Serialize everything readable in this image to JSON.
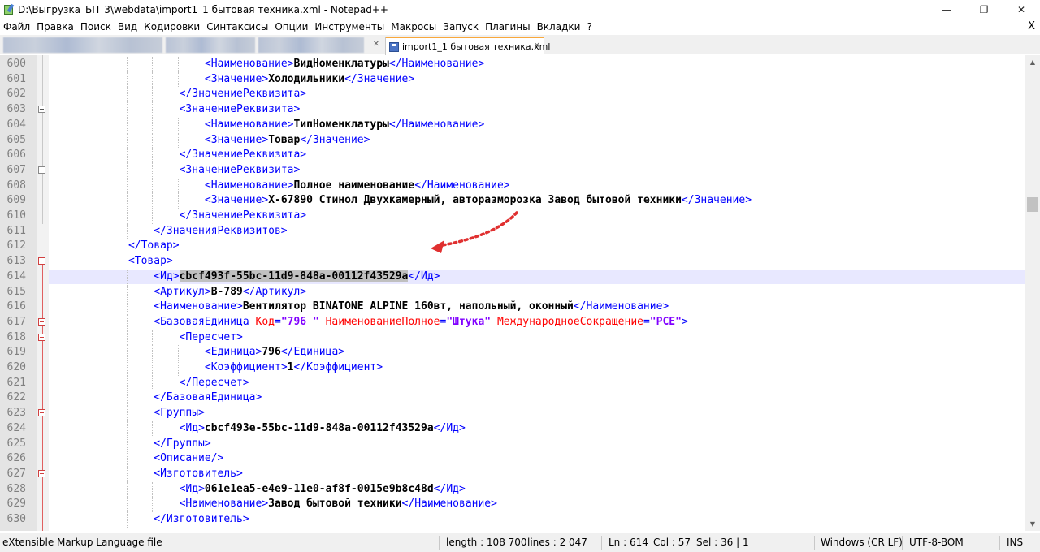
{
  "window": {
    "title": "D:\\Выгрузка_БП_3\\webdata\\import1_1 бытовая техника.xml - Notepad++",
    "minimize": "—",
    "maximize": "❐",
    "close": "✕"
  },
  "menu": {
    "items": [
      "Файл",
      "Правка",
      "Поиск",
      "Вид",
      "Кодировки",
      "Синтаксисы",
      "Опции",
      "Инструменты",
      "Макросы",
      "Запуск",
      "Плагины",
      "Вкладки",
      "?"
    ],
    "close": "X"
  },
  "tabs": {
    "active_label": "import1_1 бытовая техника.xml",
    "close_glyph": "✕"
  },
  "editor": {
    "lines": [
      {
        "n": "600",
        "parts": [
          [
            "t",
            "<Наименование>"
          ],
          [
            "x",
            "ВидНоменклатуры"
          ],
          [
            "t",
            "</Наименование>"
          ]
        ],
        "indent": 6
      },
      {
        "n": "601",
        "parts": [
          [
            "t",
            "<Значение>"
          ],
          [
            "x",
            "Холодильники"
          ],
          [
            "t",
            "</Значение>"
          ]
        ],
        "indent": 6
      },
      {
        "n": "602",
        "parts": [
          [
            "t",
            "</ЗначениеРеквизита>"
          ]
        ],
        "indent": 5
      },
      {
        "n": "603",
        "parts": [
          [
            "t",
            "<ЗначениеРеквизита>"
          ]
        ],
        "indent": 5,
        "fold": "open"
      },
      {
        "n": "604",
        "parts": [
          [
            "t",
            "<Наименование>"
          ],
          [
            "x",
            "ТипНоменклатуры"
          ],
          [
            "t",
            "</Наименование>"
          ]
        ],
        "indent": 6
      },
      {
        "n": "605",
        "parts": [
          [
            "t",
            "<Значение>"
          ],
          [
            "x",
            "Товар"
          ],
          [
            "t",
            "</Значение>"
          ]
        ],
        "indent": 6
      },
      {
        "n": "606",
        "parts": [
          [
            "t",
            "</ЗначениеРеквизита>"
          ]
        ],
        "indent": 5
      },
      {
        "n": "607",
        "parts": [
          [
            "t",
            "<ЗначениеРеквизита>"
          ]
        ],
        "indent": 5,
        "fold": "open"
      },
      {
        "n": "608",
        "parts": [
          [
            "t",
            "<Наименование>"
          ],
          [
            "x",
            "Полное наименование"
          ],
          [
            "t",
            "</Наименование>"
          ]
        ],
        "indent": 6
      },
      {
        "n": "609",
        "parts": [
          [
            "t",
            "<Значение>"
          ],
          [
            "x",
            "Х-67890 Стинол Двухкамерный, авторазморозка Завод бытовой техники"
          ],
          [
            "t",
            "</Значение>"
          ]
        ],
        "indent": 6
      },
      {
        "n": "610",
        "parts": [
          [
            "t",
            "</ЗначениеРеквизита>"
          ]
        ],
        "indent": 5
      },
      {
        "n": "611",
        "parts": [
          [
            "t",
            "</ЗначенияРеквизитов>"
          ]
        ],
        "indent": 4
      },
      {
        "n": "612",
        "parts": [
          [
            "t",
            "</Товар>"
          ]
        ],
        "indent": 3
      },
      {
        "n": "613",
        "parts": [
          [
            "t",
            "<Товар>"
          ]
        ],
        "indent": 3,
        "fold": "red"
      },
      {
        "n": "614",
        "parts": [
          [
            "t",
            "<Ид>"
          ],
          [
            "s",
            "cbcf493f-55bc-11d9-848a-00112f43529a"
          ],
          [
            "t",
            "</Ид>"
          ]
        ],
        "indent": 4,
        "current": true
      },
      {
        "n": "615",
        "parts": [
          [
            "t",
            "<Артикул>"
          ],
          [
            "x",
            "В-789"
          ],
          [
            "t",
            "</Артикул>"
          ]
        ],
        "indent": 4
      },
      {
        "n": "616",
        "parts": [
          [
            "t",
            "<Наименование>"
          ],
          [
            "x",
            "Вентилятор BINATONE ALPINE 160вт, напольный, оконный"
          ],
          [
            "t",
            "</Наименование>"
          ]
        ],
        "indent": 4
      },
      {
        "n": "617",
        "parts": [
          [
            "t",
            "<БазоваяЕдиница "
          ],
          [
            "a",
            "Код"
          ],
          [
            "t",
            "="
          ],
          [
            "v",
            "\"796 \""
          ],
          [
            "t",
            " "
          ],
          [
            "a",
            "НаименованиеПолное"
          ],
          [
            "t",
            "="
          ],
          [
            "v",
            "\"Штука\""
          ],
          [
            "t",
            " "
          ],
          [
            "a",
            "МеждународноеСокращение"
          ],
          [
            "t",
            "="
          ],
          [
            "v",
            "\"PCE\""
          ],
          [
            "t",
            ">"
          ]
        ],
        "indent": 4,
        "fold": "red"
      },
      {
        "n": "618",
        "parts": [
          [
            "t",
            "<Пересчет>"
          ]
        ],
        "indent": 5,
        "fold": "red"
      },
      {
        "n": "619",
        "parts": [
          [
            "t",
            "<Единица>"
          ],
          [
            "x",
            "796"
          ],
          [
            "t",
            "</Единица>"
          ]
        ],
        "indent": 6
      },
      {
        "n": "620",
        "parts": [
          [
            "t",
            "<Коэффициент>"
          ],
          [
            "x",
            "1"
          ],
          [
            "t",
            "</Коэффициент>"
          ]
        ],
        "indent": 6
      },
      {
        "n": "621",
        "parts": [
          [
            "t",
            "</Пересчет>"
          ]
        ],
        "indent": 5
      },
      {
        "n": "622",
        "parts": [
          [
            "t",
            "</БазоваяЕдиница>"
          ]
        ],
        "indent": 4
      },
      {
        "n": "623",
        "parts": [
          [
            "t",
            "<Группы>"
          ]
        ],
        "indent": 4,
        "fold": "red"
      },
      {
        "n": "624",
        "parts": [
          [
            "t",
            "<Ид>"
          ],
          [
            "x",
            "cbcf493e-55bc-11d9-848a-00112f43529a"
          ],
          [
            "t",
            "</Ид>"
          ]
        ],
        "indent": 5
      },
      {
        "n": "625",
        "parts": [
          [
            "t",
            "</Группы>"
          ]
        ],
        "indent": 4
      },
      {
        "n": "626",
        "parts": [
          [
            "t",
            "<Описание/>"
          ]
        ],
        "indent": 4
      },
      {
        "n": "627",
        "parts": [
          [
            "t",
            "<Изготовитель>"
          ]
        ],
        "indent": 4,
        "fold": "red"
      },
      {
        "n": "628",
        "parts": [
          [
            "t",
            "<Ид>"
          ],
          [
            "x",
            "061e1ea5-e4e9-11e0-af8f-0015e9b8c48d"
          ],
          [
            "t",
            "</Ид>"
          ]
        ],
        "indent": 5
      },
      {
        "n": "629",
        "parts": [
          [
            "t",
            "<Наименование>"
          ],
          [
            "x",
            "Завод бытовой техники"
          ],
          [
            "t",
            "</Наименование>"
          ]
        ],
        "indent": 5
      },
      {
        "n": "630",
        "parts": [
          [
            "t",
            "</Изготовитель>"
          ]
        ],
        "indent": 4
      }
    ]
  },
  "status": {
    "file_type": "eXtensible Markup Language file",
    "length": "length : 108 700",
    "lines": "lines : 2 047",
    "ln": "Ln : 614",
    "col": "Col : 57",
    "sel": "Sel : 36 | 1",
    "eol": "Windows (CR LF)",
    "encoding": "UTF-8-BOM",
    "mode": "INS"
  },
  "colors": {
    "tag": "#0000ff",
    "text": "#000000",
    "attribute": "#ff0000",
    "attribute_value": "#8000ff",
    "current_line": "#e8e8ff",
    "annotation_arrow": "#e03030",
    "active_tab_accent": "#f9a83c"
  },
  "icons": {
    "app": "notepadpp-icon",
    "tab_save": "save-icon",
    "scroll_up": "chevron-up-icon",
    "scroll_down": "chevron-down-icon"
  }
}
